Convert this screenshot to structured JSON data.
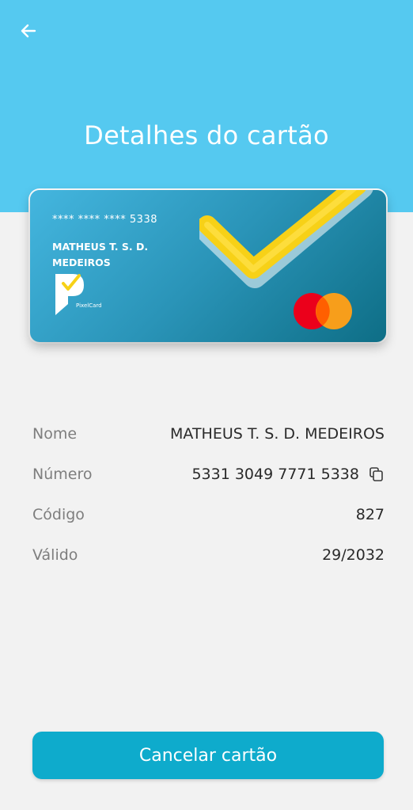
{
  "header": {
    "title": "Detalhes do cartão"
  },
  "card": {
    "masked_number": "**** **** **** 5338",
    "holder_line1": "MATHEUS T. S. D.",
    "holder_line2": "MEDEIROS",
    "brand_name": "PixelCard",
    "network": "mastercard-icon"
  },
  "details": {
    "name": {
      "label": "Nome",
      "value": "MATHEUS T. S. D. MEDEIROS"
    },
    "number": {
      "label": "Número",
      "value": "5331 3049 7771 5338"
    },
    "code": {
      "label": "Código",
      "value": "827"
    },
    "valid": {
      "label": "Válido",
      "value": "29/2032"
    }
  },
  "actions": {
    "cancel_label": "Cancelar cartão"
  },
  "colors": {
    "header": "#55c9f0",
    "button": "#0eabcc",
    "check": "#f7d117",
    "background": "#f2f2f2"
  }
}
